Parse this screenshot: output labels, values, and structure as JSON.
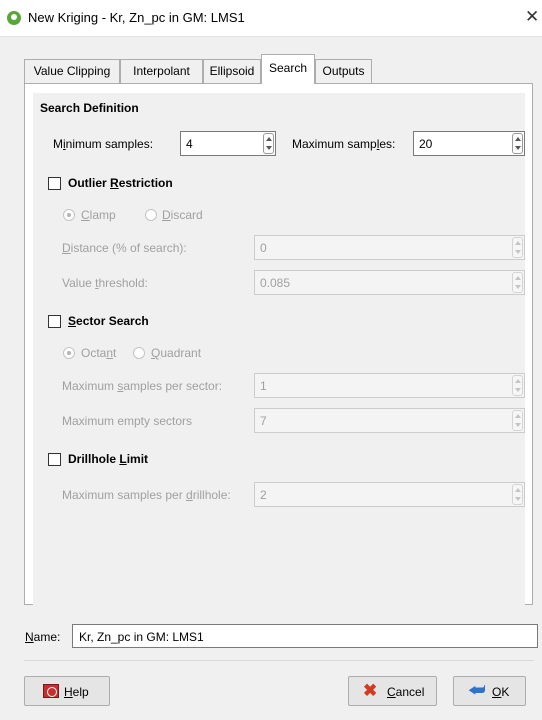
{
  "window": {
    "title": "New Kriging - Kr, Zn_pc in GM: LMS1",
    "icons": {
      "app": "leapfrog-app-icon",
      "close": "close-icon"
    }
  },
  "tabs": [
    {
      "label": "Value Clipping",
      "active": false
    },
    {
      "label": "Interpolant",
      "active": false
    },
    {
      "label": "Ellipsoid",
      "active": false
    },
    {
      "label": "Search",
      "active": true
    },
    {
      "label": "Outputs",
      "active": false
    }
  ],
  "search_definition": {
    "heading": "Search Definition",
    "min_samples": {
      "label_pre": "M",
      "label_mn": "i",
      "label_post": "nimum samples:",
      "value": "4"
    },
    "max_samples": {
      "label_pre": "Maximum samp",
      "label_mn": "l",
      "label_post": "es:",
      "value": "20"
    }
  },
  "outlier_restriction": {
    "label_pre": "Outlier ",
    "label_mn": "R",
    "label_post": "estriction",
    "checked": false,
    "clamp": {
      "label_mn": "C",
      "label_post": "lamp",
      "selected": true
    },
    "discard": {
      "label_mn": "D",
      "label_post": "iscard",
      "selected": false
    },
    "distance": {
      "label_mn": "D",
      "label_post": "istance (% of search):",
      "value": "0"
    },
    "threshold": {
      "label_pre": "Value ",
      "label_mn": "t",
      "label_post": "hreshold:",
      "value": "0.085"
    }
  },
  "sector_search": {
    "label_mn": "S",
    "label_post": "ector Search",
    "checked": false,
    "octant": {
      "label_pre": "Octa",
      "label_mn": "n",
      "label_post": "t",
      "selected": true
    },
    "quadrant": {
      "label_mn": "Q",
      "label_post": "uadrant",
      "selected": false
    },
    "max_per_sector": {
      "label_pre": "Maximum ",
      "label_mn": "s",
      "label_post": "amples per sector:",
      "value": "1"
    },
    "max_empty": {
      "label": "Maximum empty sectors",
      "value": "7"
    }
  },
  "drillhole_limit": {
    "label_pre": "Drillhole ",
    "label_mn": "L",
    "label_post": "imit",
    "checked": false,
    "max_per_drillhole": {
      "label_pre": "Maximum samples per ",
      "label_mn": "d",
      "label_post": "rillhole:",
      "value": "2"
    }
  },
  "name": {
    "label_mn": "N",
    "label_post": "ame:",
    "value": "Kr, Zn_pc in GM: LMS1"
  },
  "buttons": {
    "help": {
      "label_mn": "H",
      "label_post": "elp"
    },
    "cancel": {
      "label_mn": "C",
      "label_post": "ancel"
    },
    "ok": {
      "label_mn": "O",
      "label_post": "K"
    }
  },
  "colors": {
    "app_icon": "#5aa63a",
    "cancel_icon": "#d23b1f",
    "ok_icon": "#2e72c9",
    "help_icon": "#c62f2f"
  }
}
